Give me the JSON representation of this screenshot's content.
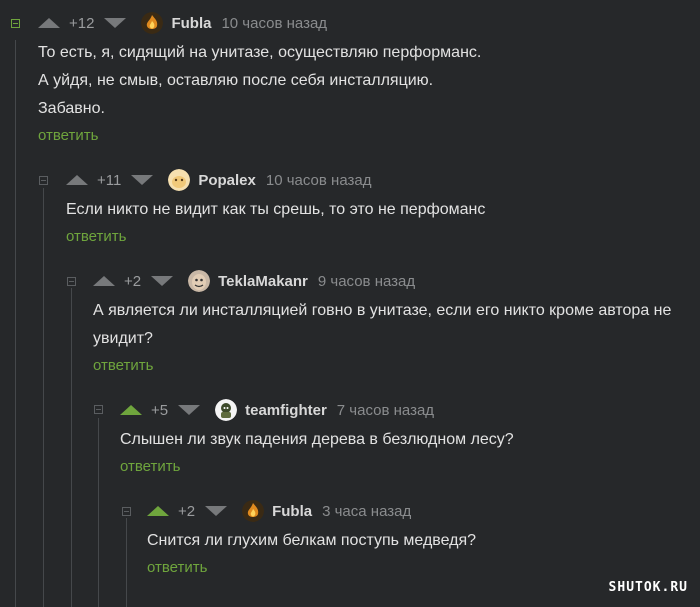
{
  "comments": [
    {
      "rating": "+12",
      "username": "Fubla",
      "time": "10 часов назад",
      "lines": [
        "То есть, я, сидящий на унитазе, осуществляю перформанс.",
        "А уйдя, не смыв, оставляю после себя инсталляцию.",
        "Забавно."
      ],
      "reply": "ответить",
      "avatar_icon": "fire-avatar-icon",
      "voted": false
    },
    {
      "rating": "+11",
      "username": "Popalex",
      "time": "10 часов назад",
      "lines": [
        "Если никто не видит как ты срешь, то это не перфоманс"
      ],
      "reply": "ответить",
      "avatar_icon": "blob-avatar-icon",
      "voted": false
    },
    {
      "rating": "+2",
      "username": "TeklaMakanr",
      "time": "9 часов назад",
      "lines": [
        "А является ли инсталляцией говно в унитазе, если его никто кроме автора не",
        "увидит?"
      ],
      "reply": "ответить",
      "avatar_icon": "face-avatar-icon",
      "voted": false
    },
    {
      "rating": "+5",
      "username": "teamfighter",
      "time": "7 часов назад",
      "lines": [
        "Слышен ли звук падения дерева в безлюдном лесу?"
      ],
      "reply": "ответить",
      "avatar_icon": "character-avatar-icon",
      "voted": true
    },
    {
      "rating": "+2",
      "username": "Fubla",
      "time": "3 часа назад",
      "lines": [
        "Снится ли глухим белкам поступь медведя?"
      ],
      "reply": "ответить",
      "avatar_icon": "fire-avatar-icon",
      "voted": true
    }
  ],
  "watermark": "SHUTOK.RU",
  "colors": {
    "background": "#26282a",
    "accent_green": "#6fa53d",
    "muted_gray": "#77797b"
  }
}
